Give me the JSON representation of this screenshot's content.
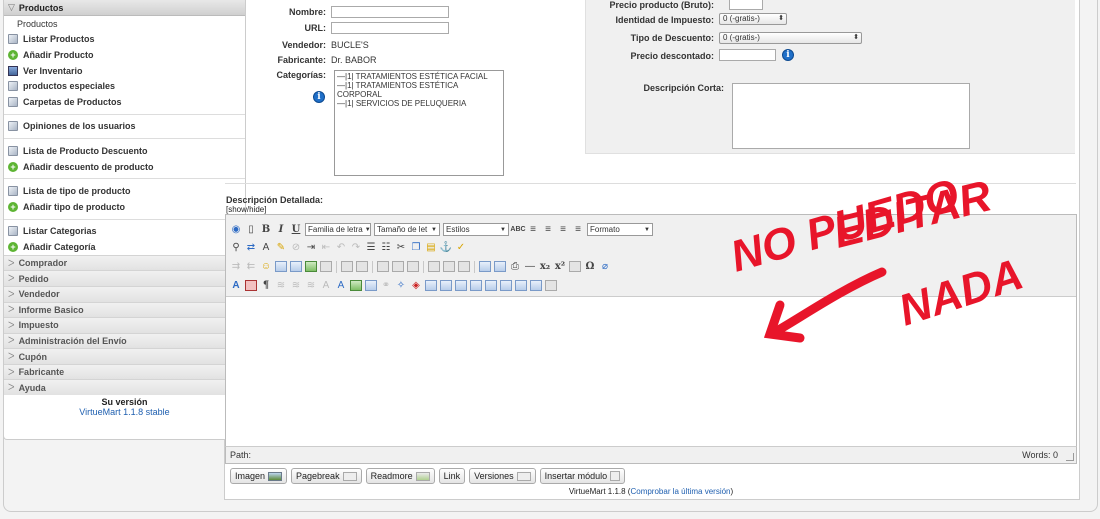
{
  "sidebar": {
    "header": "Productos",
    "items": [
      {
        "label": "Productos",
        "icon": "none"
      },
      {
        "label": "Listar Productos",
        "icon": "list-icon"
      },
      {
        "label": "Añadir Producto",
        "icon": "add-icon"
      },
      {
        "label": "Ver Inventario",
        "icon": "inventory-icon"
      },
      {
        "label": "productos especiales",
        "icon": "list-icon"
      },
      {
        "label": "Carpetas de Productos",
        "icon": "list-icon"
      },
      {
        "label": "Opiniones de los usuarios",
        "icon": "list-icon"
      },
      {
        "label": "Lista de Producto Descuento",
        "icon": "list-icon"
      },
      {
        "label": "Añadir descuento de producto",
        "icon": "add-icon"
      },
      {
        "label": "Lista de tipo de producto",
        "icon": "list-icon"
      },
      {
        "label": "Añadir tipo de producto",
        "icon": "add-icon"
      },
      {
        "label": "Listar Categorias",
        "icon": "list-icon"
      },
      {
        "label": "Añadir Categoría",
        "icon": "add-icon"
      }
    ],
    "sections": [
      "Comprador",
      "Pedido",
      "Vendedor",
      "Informe Basico",
      "Impuesto",
      "Administración del Envío",
      "Cupón",
      "Fabricante",
      "Ayuda"
    ],
    "version_title": "Su versión",
    "version_value": "VirtueMart 1.1.8 stable"
  },
  "form": {
    "nombre_label": "Nombre:",
    "url_label": "URL:",
    "vendedor_label": "Vendedor:",
    "vendedor_value": "BUCLE'S",
    "fabricante_label": "Fabricante:",
    "fabricante_value": "Dr. BABOR",
    "categorias_label": "Categorías:",
    "categories": [
      "—|1| TRATAMIENTOS ESTÉTICA FACIAL",
      "—|1| TRATAMIENTOS ESTÉTICA CORPORAL",
      "—|1| SERVICIOS DE PELUQUERIA"
    ]
  },
  "pricing": {
    "precio_bruto_label": "Precio producto (Bruto):",
    "impuesto_label": "Identidad de Impuesto:",
    "impuesto_value": "0 (-gratis-)",
    "descuento_label": "Tipo de Descuento:",
    "descuento_value": "0 (-gratis-)",
    "precio_desc_label": "Precio descontado:",
    "desc_corta_label": "Descripción Corta:"
  },
  "editor": {
    "title": "Descripción Detallada:",
    "show_hide": "[show/hide]",
    "font_family": "Familia de letra",
    "font_size": "Tamaño de let",
    "styles": "Estilos",
    "format": "Formato",
    "path_label": "Path:",
    "words": "Words: 0"
  },
  "buttons": [
    "Imagen",
    "Pagebreak",
    "Readmore",
    "Link",
    "Versiones",
    "Insertar módulo"
  ],
  "footer": {
    "text": "VirtueMart 1.1.8 (",
    "link": "Comprobar la última versión",
    "close": ")"
  },
  "annotation": {
    "line1": "NO PUEDO",
    "line2": "EDITAR",
    "line3": "NADA",
    "color": "#e8152a"
  }
}
